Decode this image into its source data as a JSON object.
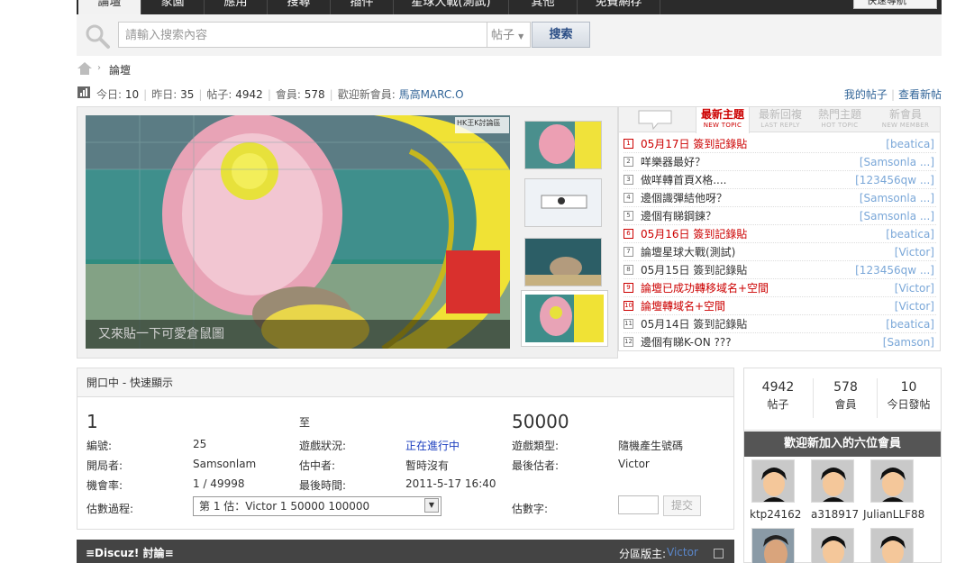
{
  "nav": {
    "tabs": [
      {
        "label": "論壇",
        "active": true
      },
      {
        "label": "家園",
        "active": false
      },
      {
        "label": "應用",
        "active": false
      },
      {
        "label": "搜尋",
        "active": false
      },
      {
        "label": "插件",
        "active": false
      },
      {
        "label": "星球大戰(測試)",
        "active": false
      },
      {
        "label": "其他",
        "active": false
      },
      {
        "label": "免費網存",
        "active": false
      }
    ],
    "quick_nav": "快速導航"
  },
  "search": {
    "placeholder": "請輸入搜索內容",
    "type": "帖子",
    "button": "搜索"
  },
  "breadcrumb": {
    "sep": "›",
    "current": "論壇"
  },
  "stats": {
    "today_label": "今日:",
    "today": "10",
    "yesterday_label": "昨日:",
    "yesterday": "35",
    "posts_label": "帖子:",
    "posts": "4942",
    "members_label": "會員:",
    "members": "578",
    "welcome_label": "歡迎新會員:",
    "newest_member": "馬高MARC.O"
  },
  "links": {
    "my_posts": "我的帖子",
    "new_posts": "查看新帖"
  },
  "slideshow": {
    "caption": "又來貼一下可愛倉鼠圖",
    "watermark": "HK王K討論區"
  },
  "topics": {
    "tabs": [
      {
        "zh": "最新主題",
        "en": "NEW TOPIC",
        "active": true
      },
      {
        "zh": "最新回複",
        "en": "LAST REPLY",
        "active": false
      },
      {
        "zh": "熱門主題",
        "en": "HOT TOPIC",
        "active": false
      },
      {
        "zh": "新會員",
        "en": "NEW MEMBER",
        "active": false
      }
    ],
    "items": [
      {
        "num": "1",
        "title": "05月17日 簽到記錄貼",
        "author": "[beatica]",
        "red": true
      },
      {
        "num": "2",
        "title": "咩樂器最好？",
        "author": "[Samsonla ...]",
        "red": false
      },
      {
        "num": "3",
        "title": "做咩轉首頁X格....",
        "author": "[123456qw ...]",
        "red": false
      },
      {
        "num": "4",
        "title": "邊個識彈結他呀？",
        "author": "[Samsonla ...]",
        "red": false
      },
      {
        "num": "5",
        "title": "邊個有睇鋼鍊？",
        "author": "[Samsonla ...]",
        "red": false
      },
      {
        "num": "6",
        "title": "05月16日 簽到記錄貼",
        "author": "[beatica]",
        "red": true
      },
      {
        "num": "7",
        "title": "論壇星球大戰(測試)",
        "author": "[Victor]",
        "red": false
      },
      {
        "num": "8",
        "title": "05月15日 簽到記錄貼",
        "author": "[123456qw ...]",
        "red": false
      },
      {
        "num": "9",
        "title": "論壇已成功轉移域名+空間",
        "author": "[Victor]",
        "red": true
      },
      {
        "num": "10",
        "title": "論壇轉域名+空間",
        "author": "[Victor]",
        "red": true
      },
      {
        "num": "11",
        "title": "05月14日 簽到記錄貼",
        "author": "[beatica]",
        "red": false
      },
      {
        "num": "12",
        "title": "邊個有睇K-ON ???",
        "author": "[Samson]",
        "red": false
      }
    ]
  },
  "game": {
    "header": "開口中 - 快速顯示",
    "min": "1",
    "to": "至",
    "max": "50000",
    "id_label": "編號:",
    "id": "25",
    "status_label": "遊戲狀況:",
    "status": "正在進行中",
    "type_label": "遊戲類型:",
    "type": "隨機產生號碼",
    "opener_label": "開局者:",
    "opener": "Samsonlam",
    "guesser_label": "估中者:",
    "guesser": "暫時沒有",
    "last_guesser_label": "最後估者:",
    "last_guesser": "Victor",
    "chance_label": "機會率:",
    "chance": "1 / 49998",
    "last_time_label": "最後時間:",
    "last_time": "2011-5-17 16:40",
    "history_label": "估數過程:",
    "history_value": "第 1 估：Victor     1      50000    100000",
    "guess_label": "估數字:",
    "submit": "提交",
    "status_color": "#1a3dbf"
  },
  "forum_bar": {
    "title": "≡Discuz! 討論≡",
    "moderator_label": "分區版主:",
    "moderator": "Victor"
  },
  "sidebar": {
    "stats": [
      {
        "value": "4942",
        "label": "帖子"
      },
      {
        "value": "578",
        "label": "會員"
      },
      {
        "value": "10",
        "label": "今日發帖"
      }
    ],
    "new_members_title": "歡迎新加入的六位會員",
    "members": [
      "ktp24162",
      "a318917",
      "JulianLLF88"
    ]
  },
  "colors": {
    "nav_bg": "#2b2b2b",
    "accent_red": "#cc0000",
    "link_blue": "#336699"
  }
}
